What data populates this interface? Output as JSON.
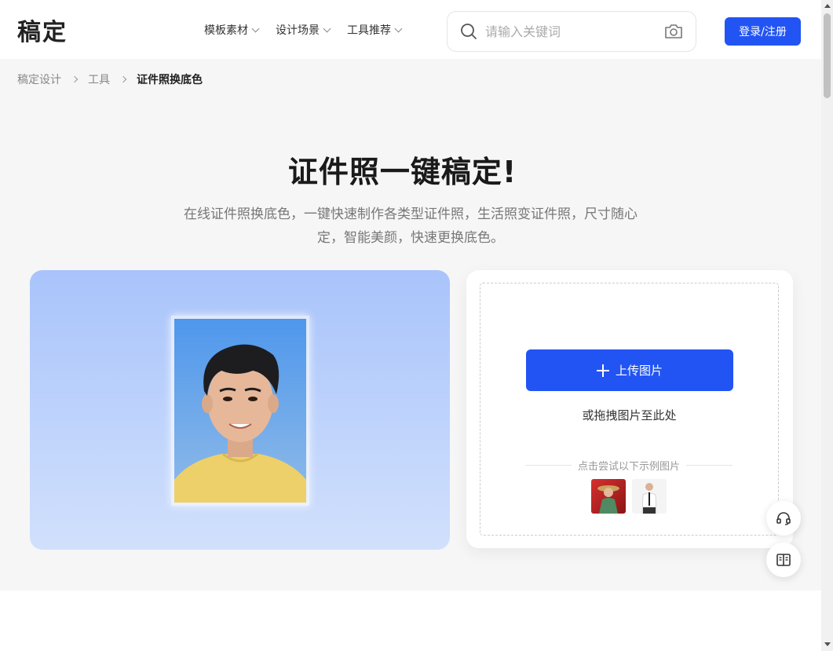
{
  "header": {
    "logo": "稿定",
    "nav": [
      {
        "label": "模板素材"
      },
      {
        "label": "设计场景"
      },
      {
        "label": "工具推荐"
      }
    ],
    "search_placeholder": "请输入关键词",
    "login_label": "登录/注册"
  },
  "breadcrumb": {
    "items": [
      "稿定设计",
      "工具"
    ],
    "current": "证件照换底色"
  },
  "hero": {
    "title": "证件照一键稿定!",
    "subtitle": "在线证件照换底色，一键快速制作各类型证件照，生活照变证件照，尺寸随心定，智能美颜，快速更换底色。"
  },
  "upload": {
    "button_label": "上传图片",
    "drag_text": "或拖拽图片至此处",
    "sample_label": "点击尝试以下示例图片"
  },
  "colors": {
    "accent": "#2254f4",
    "background": "#f6f6f7",
    "preview_gradient_top": "#a9c4fb",
    "preview_gradient_bottom": "#d1e0fc"
  },
  "icons": {
    "search": "search-icon",
    "camera": "camera-icon",
    "headset": "headset-icon",
    "book": "book-icon"
  }
}
